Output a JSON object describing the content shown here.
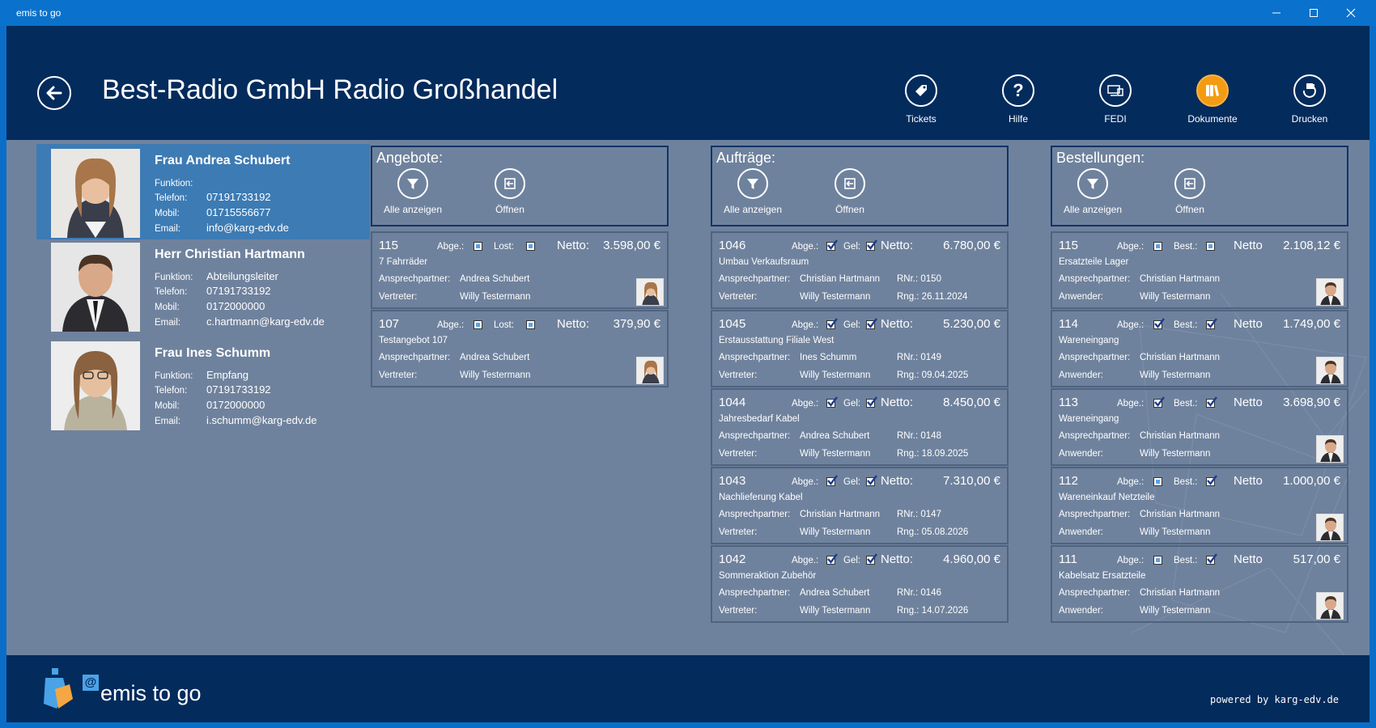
{
  "window": {
    "title": "emis to go"
  },
  "header": {
    "title": "Best-Radio GmbH Radio Großhandel",
    "buttons": [
      {
        "label": "Tickets",
        "icon": "tag-icon"
      },
      {
        "label": "Hilfe",
        "icon": "help-icon"
      },
      {
        "label": "FEDI",
        "icon": "devices-icon"
      },
      {
        "label": "Dokumente",
        "icon": "books-icon"
      },
      {
        "label": "Drucken",
        "icon": "print-icon"
      }
    ]
  },
  "contacts": [
    {
      "name": "Frau Andrea Schubert",
      "funktion": "",
      "telefon": "07191733192",
      "mobil": "01715556677",
      "email": "info@karg-edv.de"
    },
    {
      "name": "Herr Christian Hartmann",
      "funktion": "Abteilungsleiter",
      "telefon": "07191733192",
      "mobil": "0172000000",
      "email": "c.hartmann@karg-edv.de"
    },
    {
      "name": "Frau Ines Schumm",
      "funktion": "Empfang",
      "telefon": "07191733192",
      "mobil": "0172000000",
      "email": "i.schumm@karg-edv.de"
    }
  ],
  "labels": {
    "funktion": "Funktion:",
    "telefon": "Telefon:",
    "mobil": "Mobil:",
    "email": "Email:",
    "alle": "Alle anzeigen",
    "oeffnen": "Öffnen",
    "abge": "Abge.:",
    "lost": "Lost:",
    "gel": "Gel:",
    "best": "Best.:",
    "netto_colon": "Netto:",
    "netto": "Netto",
    "ansprech": "Ansprechpartner:",
    "vertreter": "Vertreter:",
    "anwender": "Anwender:"
  },
  "sections": {
    "angebote": "Angebote:",
    "auftraege": "Aufträge:",
    "bestellungen": "Bestellungen:"
  },
  "angebote": [
    {
      "num": "115",
      "abge": false,
      "lost": false,
      "amount": "3.598,00 €",
      "desc": "7 Fahrräder",
      "ansprech": "Andrea Schubert",
      "vertreter": "Willy Testermann"
    },
    {
      "num": "107",
      "abge": false,
      "lost": false,
      "amount": "379,90 €",
      "desc": "Testangebot 107",
      "ansprech": "Andrea Schubert",
      "vertreter": "Willy Testermann"
    }
  ],
  "auftraege": [
    {
      "num": "1046",
      "abge": true,
      "gel": true,
      "amount": "6.780,00 €",
      "desc": "Umbau Verkaufsraum",
      "ansprech": "Christian Hartmann",
      "vertreter": "Willy Testermann",
      "rnr": "RNr.: 0150",
      "rng": "Rng.: 26.11.2024"
    },
    {
      "num": "1045",
      "abge": true,
      "gel": true,
      "amount": "5.230,00 €",
      "desc": "Erstausstattung Filiale West",
      "ansprech": "Ines Schumm",
      "vertreter": "Willy Testermann",
      "rnr": "RNr.: 0149",
      "rng": "Rng.: 09.04.2025"
    },
    {
      "num": "1044",
      "abge": true,
      "gel": true,
      "amount": "8.450,00 €",
      "desc": "Jahresbedarf Kabel",
      "ansprech": "Andrea Schubert",
      "vertreter": "Willy Testermann",
      "rnr": "RNr.: 0148",
      "rng": "Rng.: 18.09.2025"
    },
    {
      "num": "1043",
      "abge": true,
      "gel": true,
      "amount": "7.310,00 €",
      "desc": "Nachlieferung Kabel",
      "ansprech": "Christian Hartmann",
      "vertreter": "Willy Testermann",
      "rnr": "RNr.: 0147",
      "rng": "Rng.: 05.08.2026"
    },
    {
      "num": "1042",
      "abge": true,
      "gel": true,
      "amount": "4.960,00 €",
      "desc": "Sommeraktion Zubehör",
      "ansprech": "Andrea Schubert",
      "vertreter": "Willy Testermann",
      "rnr": "RNr.: 0146",
      "rng": "Rng.: 14.07.2026"
    }
  ],
  "bestellungen": [
    {
      "num": "115",
      "abge": false,
      "best": false,
      "amount": "2.108,12 €",
      "desc": "Ersatzteile Lager",
      "ansprech": "Christian Hartmann",
      "anwender": "Willy Testermann"
    },
    {
      "num": "114",
      "abge": true,
      "best": true,
      "amount": "1.749,00 €",
      "desc": "Wareneingang",
      "ansprech": "Christian Hartmann",
      "anwender": "Willy Testermann"
    },
    {
      "num": "113",
      "abge": true,
      "best": true,
      "amount": "3.698,90 €",
      "desc": "Wareneingang",
      "ansprech": "Christian Hartmann",
      "anwender": "Willy Testermann"
    },
    {
      "num": "112",
      "abge": false,
      "best": true,
      "amount": "1.000,00 €",
      "desc": "Wareneinkauf Netzteile",
      "ansprech": "Christian Hartmann",
      "anwender": "Willy Testermann"
    },
    {
      "num": "111",
      "abge": false,
      "best": true,
      "amount": "517,00 €",
      "desc": "Kabelsatz Ersatzteile",
      "ansprech": "Christian Hartmann",
      "anwender": "Willy Testermann"
    }
  ],
  "footer": {
    "app_name": "emis to go",
    "powered": "powered by karg-edv.de",
    "at_symbol": "@"
  },
  "colors": {
    "header": "#032b5c",
    "body": "#6f829d",
    "selected": "#3d7bb4",
    "accent": "#f39c12"
  }
}
